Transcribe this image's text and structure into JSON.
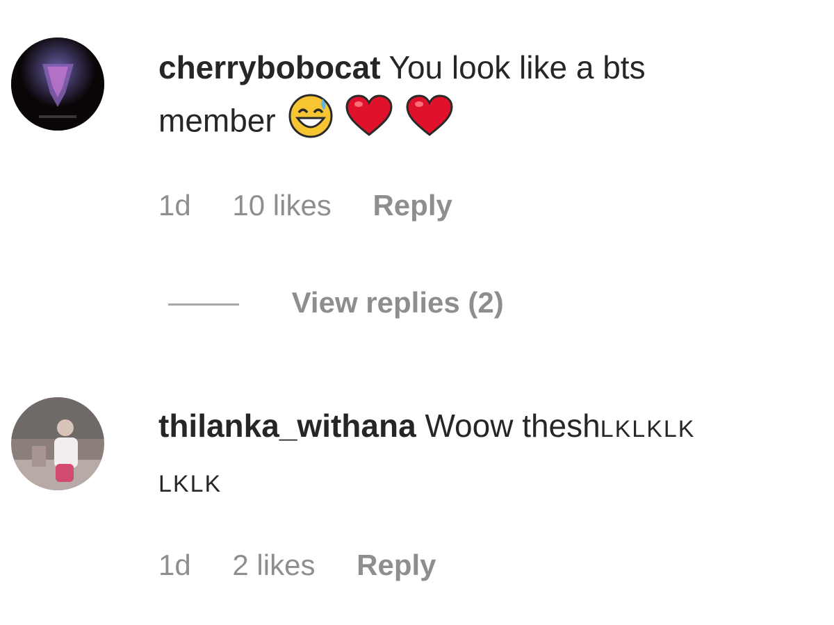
{
  "comments": [
    {
      "username": "cherrybobocat",
      "text_line1": "You look like a bts",
      "text_line2": "member",
      "emojis": [
        "grinning-sweat-emoji",
        "red-heart-emoji",
        "red-heart-emoji"
      ],
      "time": "1d",
      "likes": "10 likes",
      "reply": "Reply",
      "view_replies": "View replies (2)"
    },
    {
      "username": "thilanka_withana",
      "text_line1": "Woow thesh",
      "text_line1_caps": "LKLKLK",
      "text_line2": "LKLK",
      "time": "1d",
      "likes": "2 likes",
      "reply": "Reply"
    }
  ],
  "colors": {
    "text": "#262626",
    "meta": "#8e8e8e",
    "heart": "#e0112b",
    "emoji_face": "#f7c531"
  }
}
